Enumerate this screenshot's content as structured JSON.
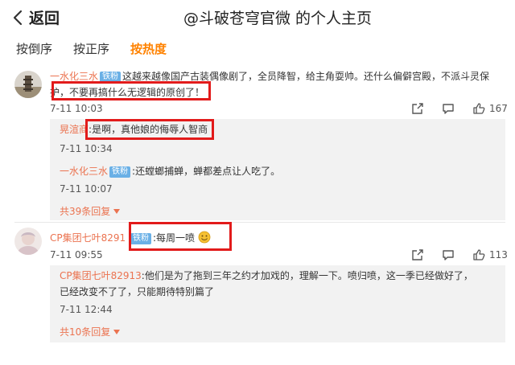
{
  "header": {
    "back_label": "返回",
    "title": "@斗破苍穹官微 的个人主页"
  },
  "sort_tabs": [
    {
      "label": "按倒序",
      "active": false
    },
    {
      "label": "按正序",
      "active": false
    },
    {
      "label": "按热度",
      "active": true
    }
  ],
  "badge_label": "铁粉",
  "comments": [
    {
      "author": "一水化三水",
      "text_line1": "这越来越像国产古装偶像剧了，全员降智，给主角耍帅。还什么偏僻宫殿，不派斗灵保",
      "text_line2": "护，不要再搞什么无逻辑的原创了！",
      "time": "7-11 10:03",
      "likes": "167",
      "replies": [
        {
          "author": "晃渲商",
          "text": "是啊，真他娘的侮辱人智商",
          "time": "7-11 10:34"
        },
        {
          "author": "一水化三水",
          "text": "还螳螂捕蝉，蝉都差点让人吃了。",
          "time": "7-11 10:07"
        }
      ],
      "more_replies": "共39条回复"
    },
    {
      "author": "CP集团七叶8291",
      "text_line1": "每周一喷",
      "time": "7-11 09:55",
      "likes": "113",
      "replies": [
        {
          "author": "CP集团七叶82913",
          "text_line1": "他们是为了拖到三年之约才加戏的，理解一下。喷归喷，这一季已经做好了，",
          "text_line2": "已经改变不了了，只能期待特别篇了",
          "time": "7-11 12:44"
        }
      ],
      "more_replies": "共10条回复"
    }
  ],
  "colors": {
    "accent": "#ff8200",
    "name": "#eb7350",
    "badge": "#6ab0e6",
    "highlight": "#e21b1b"
  }
}
